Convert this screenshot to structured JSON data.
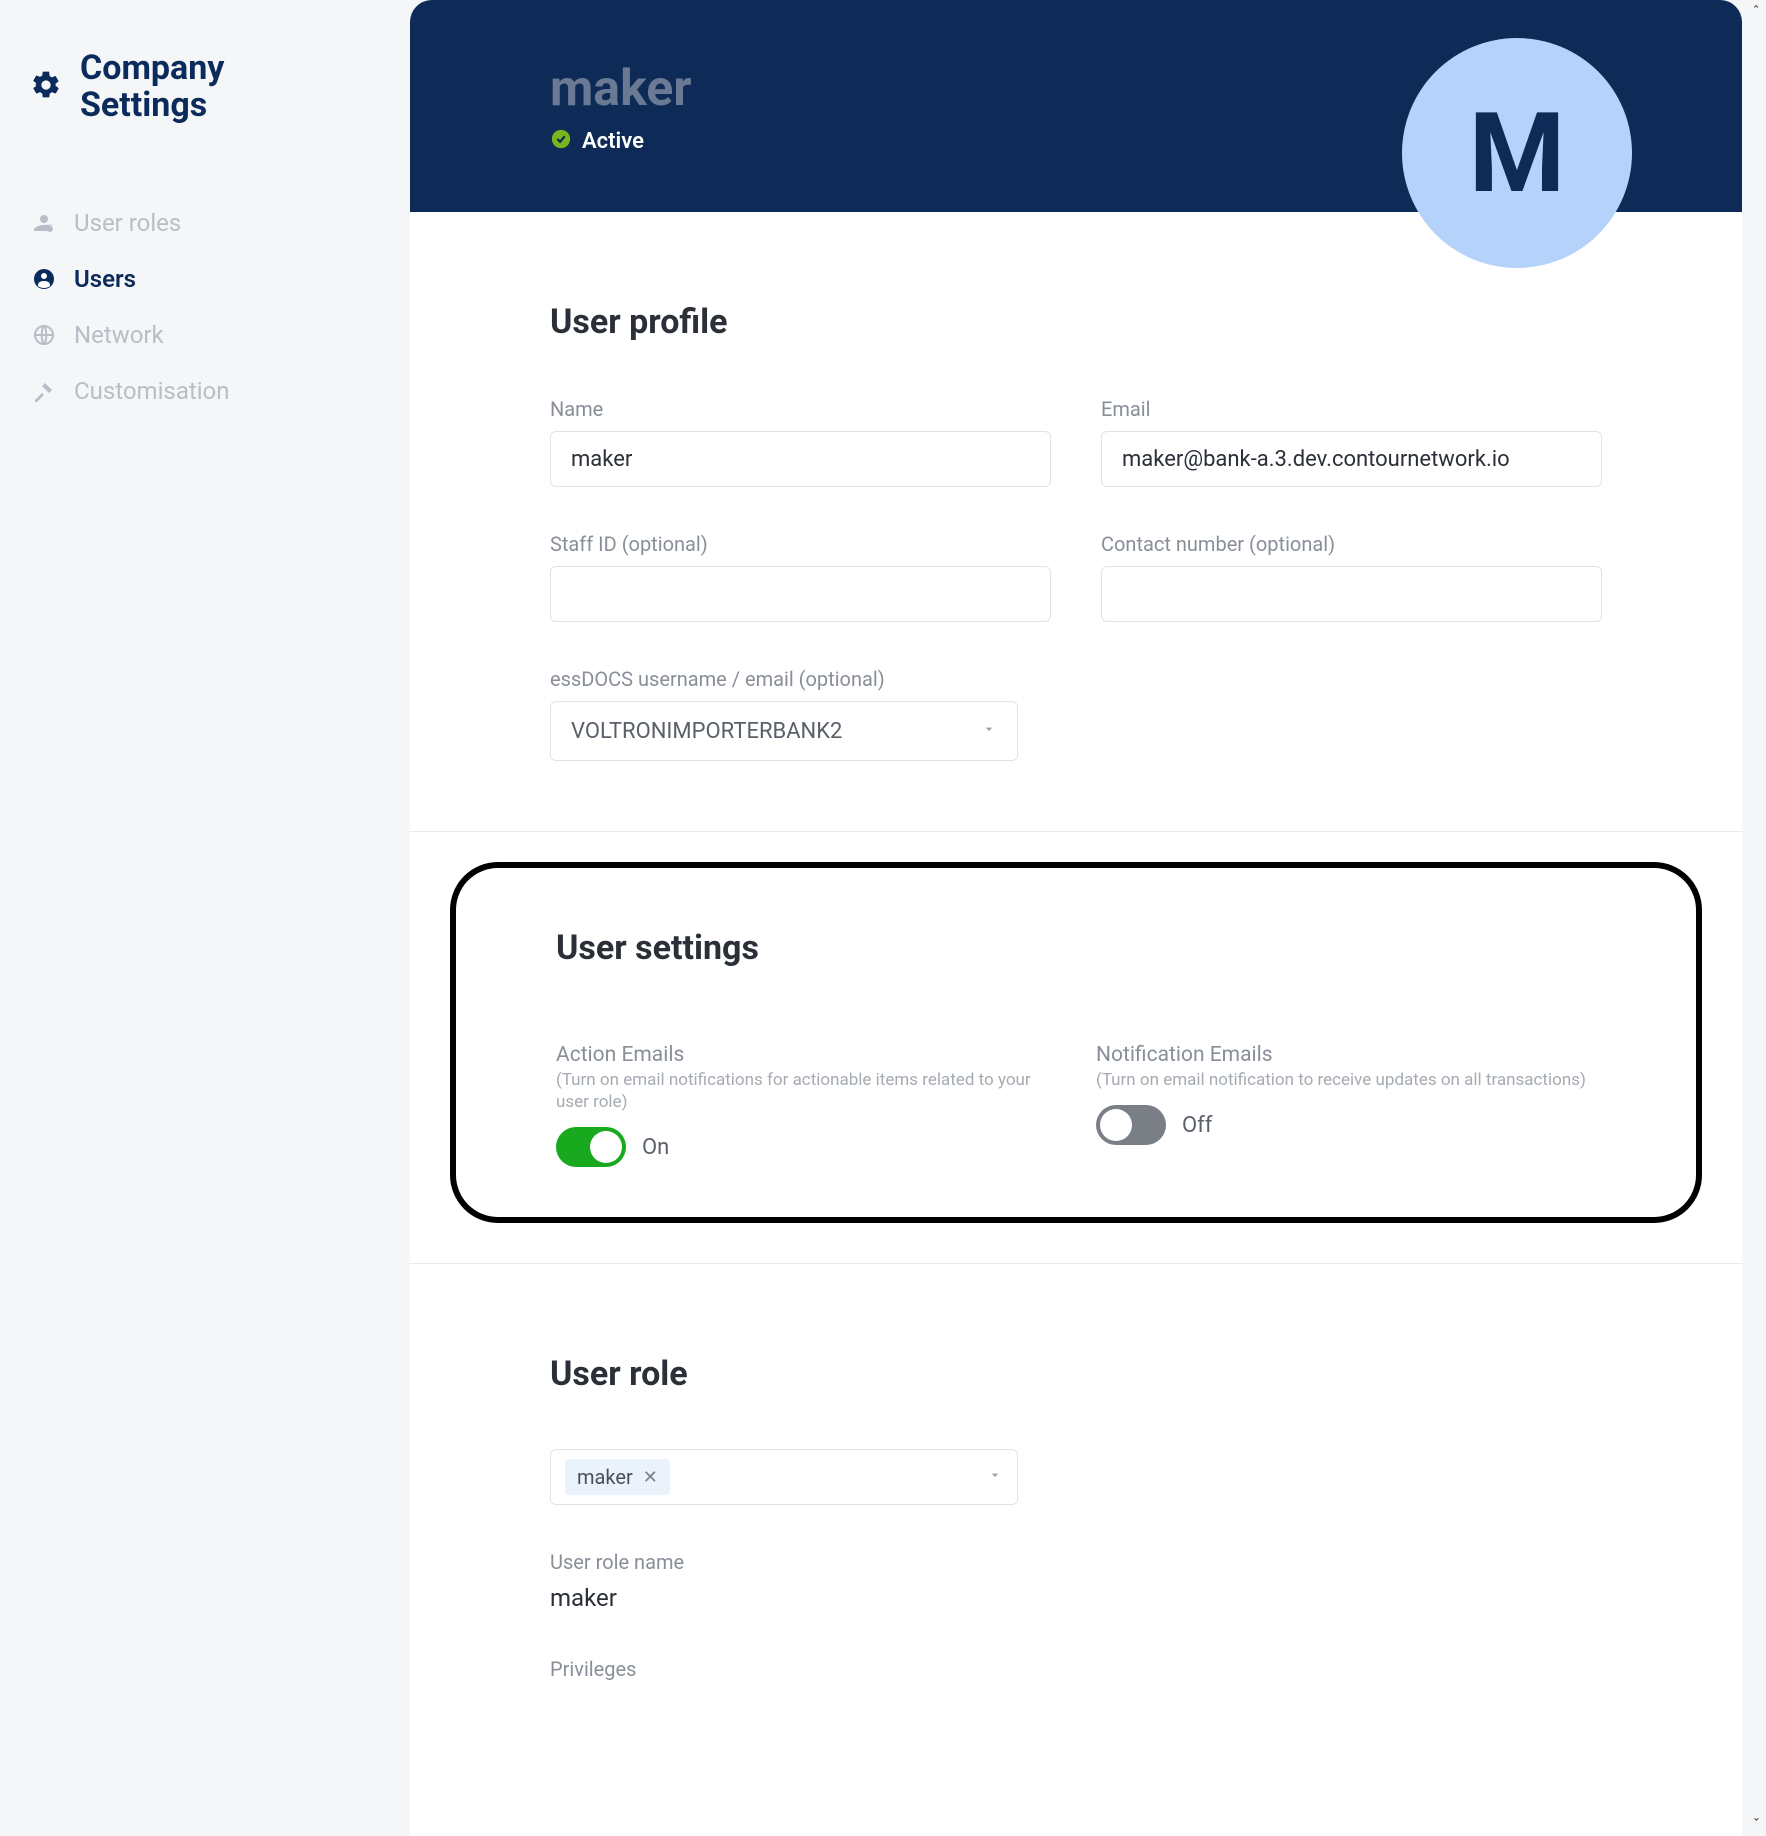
{
  "brand": {
    "title_line1": "Company",
    "title_line2": "Settings"
  },
  "nav": {
    "items": [
      {
        "label": "User roles",
        "active": false
      },
      {
        "label": "Users",
        "active": true
      },
      {
        "label": "Network",
        "active": false
      },
      {
        "label": "Customisation",
        "active": false
      }
    ]
  },
  "header": {
    "title": "maker",
    "status": "Active",
    "avatar_letter": "M"
  },
  "profile": {
    "section_title": "User profile",
    "name_label": "Name",
    "name_value": "maker",
    "email_label": "Email",
    "email_value": "maker@bank-a.3.dev.contournetwork.io",
    "staff_id_label": "Staff ID (optional)",
    "staff_id_value": "",
    "contact_label": "Contact number (optional)",
    "contact_value": "",
    "essdocs_label": "essDOCS username / email (optional)",
    "essdocs_value": "VOLTRONIMPORTERBANK2"
  },
  "user_settings": {
    "section_title": "User settings",
    "action_emails": {
      "title": "Action Emails",
      "hint": "(Turn on email notifications for actionable items related to your user role)",
      "state_label": "On",
      "on": true
    },
    "notification_emails": {
      "title": "Notification Emails",
      "hint": "(Turn on email notification to receive updates on all transactions)",
      "state_label": "Off",
      "on": false
    }
  },
  "user_role": {
    "section_title": "User role",
    "chip_label": "maker",
    "role_name_label": "User role name",
    "role_name_value": "maker",
    "privileges_label": "Privileges"
  }
}
